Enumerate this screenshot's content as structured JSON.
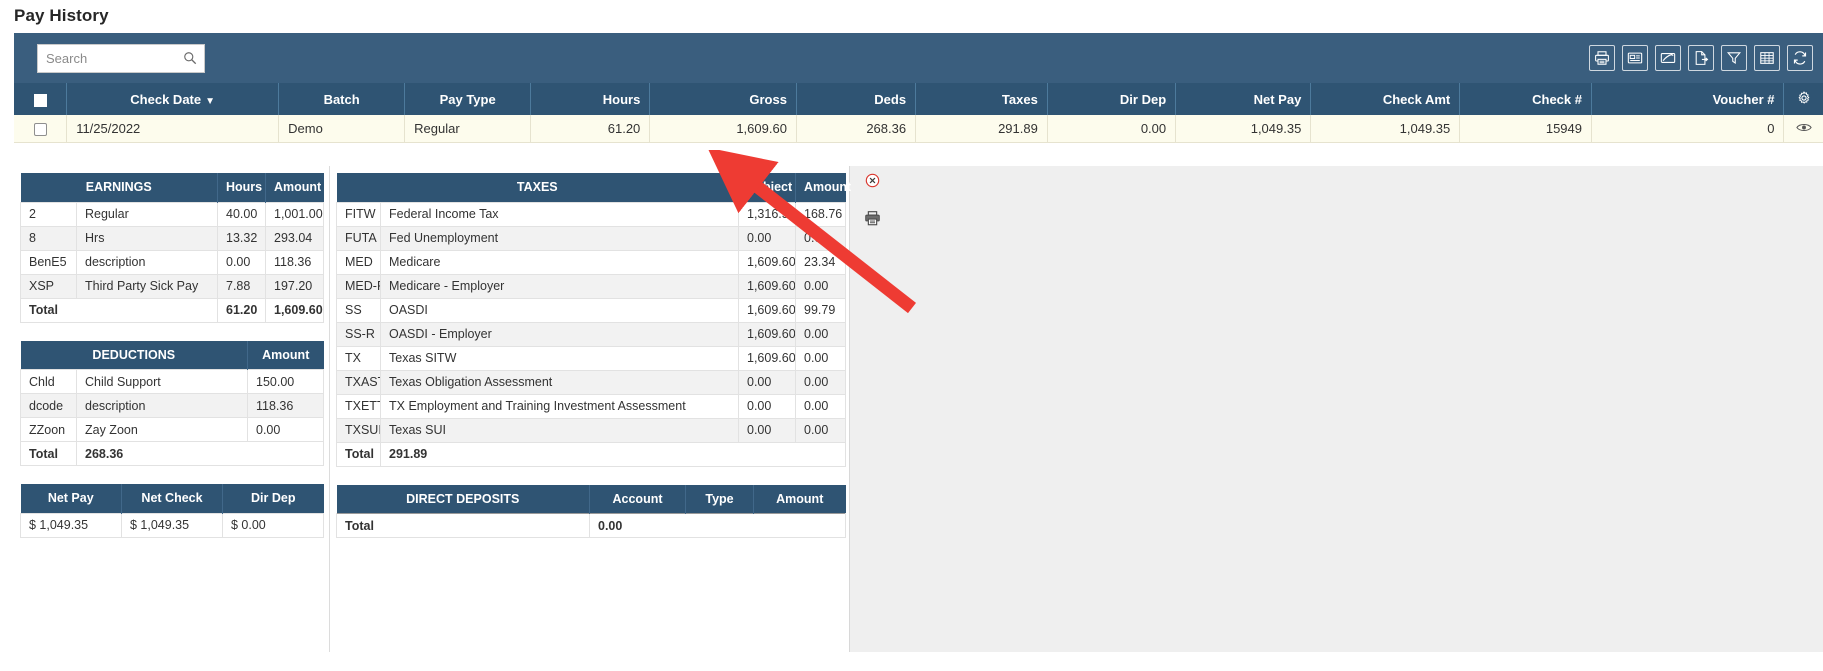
{
  "page": {
    "title": "Pay History"
  },
  "search": {
    "placeholder": "Search",
    "value": "",
    "icon": "search-icon"
  },
  "toolbar": {
    "icons": [
      {
        "name": "print-icon",
        "label": "Print"
      },
      {
        "name": "check-stub-icon",
        "label": "Check Stub"
      },
      {
        "name": "signed-check-icon",
        "label": "Signed Check"
      },
      {
        "name": "export-file-icon",
        "label": "Export"
      },
      {
        "name": "filter-icon",
        "label": "Filter"
      },
      {
        "name": "grid-columns-icon",
        "label": "Columns"
      },
      {
        "name": "refresh-icon",
        "label": "Refresh"
      }
    ]
  },
  "grid": {
    "columns": [
      {
        "key": "select",
        "label": "",
        "align": "center"
      },
      {
        "key": "date",
        "label": "Check Date",
        "align": "center",
        "sorted": "desc",
        "sort_glyph": "▼"
      },
      {
        "key": "batch",
        "label": "Batch",
        "align": "center"
      },
      {
        "key": "paytype",
        "label": "Pay Type",
        "align": "center"
      },
      {
        "key": "hours",
        "label": "Hours",
        "align": "right"
      },
      {
        "key": "gross",
        "label": "Gross",
        "align": "right"
      },
      {
        "key": "deds",
        "label": "Deds",
        "align": "right"
      },
      {
        "key": "taxes",
        "label": "Taxes",
        "align": "right"
      },
      {
        "key": "dirdep",
        "label": "Dir Dep",
        "align": "right"
      },
      {
        "key": "netpay",
        "label": "Net Pay",
        "align": "right"
      },
      {
        "key": "checkamt",
        "label": "Check Amt",
        "align": "right"
      },
      {
        "key": "checknum",
        "label": "Check #",
        "align": "right"
      },
      {
        "key": "voucher",
        "label": "Voucher #",
        "align": "right"
      },
      {
        "key": "gear",
        "label": "",
        "align": "center",
        "icon": "gear-icon"
      }
    ],
    "rows": [
      {
        "date": "11/25/2022",
        "batch": "Demo",
        "paytype": "Regular",
        "hours": "61.20",
        "gross": "1,609.60",
        "deds": "268.36",
        "taxes": "291.89",
        "dirdep": "0.00",
        "netpay": "1,049.35",
        "checkamt": "1,049.35",
        "checknum": "15949",
        "voucher": "0",
        "row_action_icon": "eye-icon",
        "selected": false
      }
    ]
  },
  "detail": {
    "close_icon": "close-circle-icon",
    "print_icon": "print-icon",
    "earnings": {
      "title": "EARNINGS",
      "headers": [
        "EARNINGS",
        "Hours",
        "Amount"
      ],
      "rows": [
        {
          "code": "2",
          "desc": "Regular",
          "hours": "40.00",
          "amount": "1,001.00"
        },
        {
          "code": "8",
          "desc": "Hrs",
          "hours": "13.32",
          "amount": "293.04"
        },
        {
          "code": "BenE5",
          "desc": "description",
          "hours": "0.00",
          "amount": "118.36"
        },
        {
          "code": "XSP",
          "desc": "Third Party Sick Pay",
          "hours": "7.88",
          "amount": "197.20"
        }
      ],
      "total_label": "Total",
      "total_hours": "61.20",
      "total_amount": "1,609.60"
    },
    "deductions": {
      "title": "DEDUCTIONS",
      "headers": [
        "DEDUCTIONS",
        "Amount"
      ],
      "rows": [
        {
          "code": "Chld",
          "desc": "Child Support",
          "amount": "150.00"
        },
        {
          "code": "dcode",
          "desc": "description",
          "amount": "118.36"
        },
        {
          "code": "ZZoon",
          "desc": "Zay Zoon",
          "amount": "0.00"
        }
      ],
      "total_label": "Total",
      "total_amount": "268.36"
    },
    "netpay": {
      "headers": [
        "Net Pay",
        "Net Check",
        "Dir Dep"
      ],
      "values": [
        "$ 1,049.35",
        "$ 1,049.35",
        "$ 0.00"
      ]
    },
    "taxes": {
      "title": "TAXES",
      "headers": [
        "TAXES",
        "Subject",
        "Amount"
      ],
      "rows": [
        {
          "code": "FITW",
          "desc": "Federal Income Tax",
          "subject": "1,316.56",
          "amount": "168.76"
        },
        {
          "code": "FUTA",
          "desc": "Fed Unemployment",
          "subject": "0.00",
          "amount": "0.00"
        },
        {
          "code": "MED",
          "desc": "Medicare",
          "subject": "1,609.60",
          "amount": "23.34"
        },
        {
          "code": "MED-R",
          "desc": "Medicare - Employer",
          "subject": "1,609.60",
          "amount": "0.00"
        },
        {
          "code": "SS",
          "desc": "OASDI",
          "subject": "1,609.60",
          "amount": "99.79"
        },
        {
          "code": "SS-R",
          "desc": "OASDI - Employer",
          "subject": "1,609.60",
          "amount": "0.00"
        },
        {
          "code": "TX",
          "desc": "Texas SITW",
          "subject": "1,609.60",
          "amount": "0.00"
        },
        {
          "code": "TXAST",
          "desc": "Texas Obligation Assessment",
          "subject": "0.00",
          "amount": "0.00"
        },
        {
          "code": "TXETT",
          "desc": "TX Employment and Training Investment Assessment",
          "subject": "0.00",
          "amount": "0.00"
        },
        {
          "code": "TXSUI",
          "desc": "Texas SUI",
          "subject": "0.00",
          "amount": "0.00"
        }
      ],
      "total_label": "Total",
      "total_amount": "291.89"
    },
    "direct_deposits": {
      "title": "DIRECT DEPOSITS",
      "headers": [
        "DIRECT DEPOSITS",
        "Account",
        "Type",
        "Amount"
      ],
      "rows": [],
      "total_label": "Total",
      "total_amount": "0.00"
    }
  },
  "annotation": {
    "arrow_color": "#ee3b33",
    "points_to": "close-circle-icon"
  },
  "colors": {
    "header_blue": "#2f5473",
    "toolbar_blue": "#3a5e7e",
    "row_cream": "#fdfced",
    "page_bg": "#ffffff",
    "right_bg": "#efefef"
  }
}
